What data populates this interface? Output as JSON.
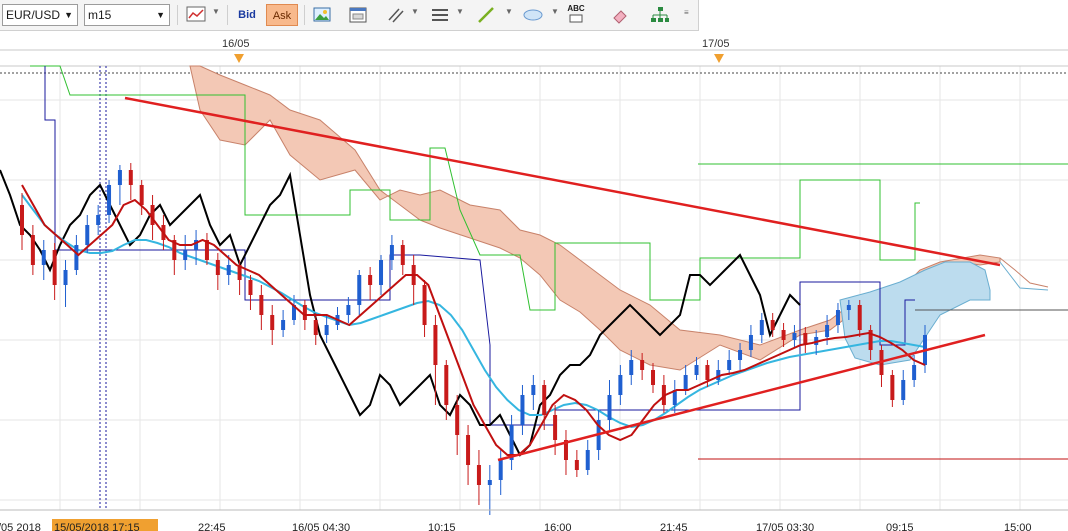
{
  "toolbar": {
    "symbol": "EUR/USD",
    "timeframe": "m15",
    "bid_label": "Bid",
    "ask_label": "Ask",
    "text_tool_label": "ABC"
  },
  "chart_data": {
    "type": "line",
    "date_markers": [
      "16/05",
      "17/05"
    ],
    "x_ticks": [
      "/05 2018",
      "15/05/2018 17:15",
      "22:45",
      "16/05 04:30",
      "10:15",
      "16:00",
      "21:45",
      "17/05 03:30",
      "09:15",
      "15:00"
    ],
    "highlighted_tick": "15/05/2018 17:15",
    "colors": {
      "candle_up": "#1f5fd0",
      "candle_down": "#c81a1a",
      "black_line": "#000000",
      "red_line": "#c01010",
      "cyan_line": "#35b6e0",
      "green_line": "#30c030",
      "navy_line": "#1a1a9e",
      "cloud_bear": "#f3c8b5",
      "cloud_bull": "#bcdcee",
      "trendline": "#e02020"
    },
    "candles": [
      {
        "o": 130,
        "c": 160,
        "h": 118,
        "l": 175
      },
      {
        "o": 160,
        "c": 190,
        "h": 150,
        "l": 200
      },
      {
        "o": 190,
        "c": 175,
        "h": 165,
        "l": 205
      },
      {
        "o": 175,
        "c": 210,
        "h": 168,
        "l": 225
      },
      {
        "o": 210,
        "c": 195,
        "h": 185,
        "l": 232
      },
      {
        "o": 195,
        "c": 170,
        "h": 160,
        "l": 200
      },
      {
        "o": 170,
        "c": 150,
        "h": 140,
        "l": 178
      },
      {
        "o": 150,
        "c": 140,
        "h": 130,
        "l": 160
      },
      {
        "o": 140,
        "c": 110,
        "h": 105,
        "l": 148
      },
      {
        "o": 110,
        "c": 95,
        "h": 90,
        "l": 130
      },
      {
        "o": 95,
        "c": 110,
        "h": 88,
        "l": 125
      },
      {
        "o": 110,
        "c": 130,
        "h": 105,
        "l": 140
      },
      {
        "o": 130,
        "c": 150,
        "h": 120,
        "l": 165
      },
      {
        "o": 150,
        "c": 165,
        "h": 140,
        "l": 175
      },
      {
        "o": 165,
        "c": 185,
        "h": 160,
        "l": 200
      },
      {
        "o": 185,
        "c": 175,
        "h": 160,
        "l": 195
      },
      {
        "o": 175,
        "c": 165,
        "h": 155,
        "l": 190
      },
      {
        "o": 165,
        "c": 185,
        "h": 158,
        "l": 190
      },
      {
        "o": 185,
        "c": 200,
        "h": 178,
        "l": 215
      },
      {
        "o": 200,
        "c": 190,
        "h": 180,
        "l": 210
      },
      {
        "o": 190,
        "c": 205,
        "h": 185,
        "l": 220
      },
      {
        "o": 205,
        "c": 220,
        "h": 200,
        "l": 235
      },
      {
        "o": 220,
        "c": 240,
        "h": 210,
        "l": 255
      },
      {
        "o": 240,
        "c": 255,
        "h": 230,
        "l": 270
      },
      {
        "o": 255,
        "c": 245,
        "h": 235,
        "l": 262
      },
      {
        "o": 245,
        "c": 230,
        "h": 220,
        "l": 250
      },
      {
        "o": 230,
        "c": 245,
        "h": 225,
        "l": 255
      },
      {
        "o": 245,
        "c": 260,
        "h": 238,
        "l": 270
      },
      {
        "o": 260,
        "c": 250,
        "h": 240,
        "l": 268
      },
      {
        "o": 250,
        "c": 240,
        "h": 232,
        "l": 255
      },
      {
        "o": 240,
        "c": 230,
        "h": 222,
        "l": 248
      },
      {
        "o": 230,
        "c": 200,
        "h": 195,
        "l": 240
      },
      {
        "o": 200,
        "c": 210,
        "h": 192,
        "l": 225
      },
      {
        "o": 210,
        "c": 185,
        "h": 180,
        "l": 220
      },
      {
        "o": 185,
        "c": 170,
        "h": 160,
        "l": 195
      },
      {
        "o": 170,
        "c": 190,
        "h": 165,
        "l": 200
      },
      {
        "o": 190,
        "c": 210,
        "h": 180,
        "l": 230
      },
      {
        "o": 210,
        "c": 250,
        "h": 205,
        "l": 262
      },
      {
        "o": 250,
        "c": 290,
        "h": 240,
        "l": 330
      },
      {
        "o": 290,
        "c": 330,
        "h": 285,
        "l": 345
      },
      {
        "o": 330,
        "c": 360,
        "h": 320,
        "l": 380
      },
      {
        "o": 360,
        "c": 390,
        "h": 350,
        "l": 410
      },
      {
        "o": 390,
        "c": 410,
        "h": 375,
        "l": 430
      },
      {
        "o": 410,
        "c": 405,
        "h": 390,
        "l": 440
      },
      {
        "o": 405,
        "c": 385,
        "h": 375,
        "l": 420
      },
      {
        "o": 385,
        "c": 350,
        "h": 340,
        "l": 395
      },
      {
        "o": 350,
        "c": 320,
        "h": 310,
        "l": 360
      },
      {
        "o": 320,
        "c": 310,
        "h": 300,
        "l": 335
      },
      {
        "o": 310,
        "c": 340,
        "h": 305,
        "l": 355
      },
      {
        "o": 340,
        "c": 365,
        "h": 330,
        "l": 380
      },
      {
        "o": 365,
        "c": 385,
        "h": 355,
        "l": 400
      },
      {
        "o": 385,
        "c": 395,
        "h": 375,
        "l": 402
      },
      {
        "o": 395,
        "c": 375,
        "h": 365,
        "l": 400
      },
      {
        "o": 375,
        "c": 345,
        "h": 335,
        "l": 385
      },
      {
        "o": 345,
        "c": 320,
        "h": 305,
        "l": 355
      },
      {
        "o": 320,
        "c": 300,
        "h": 290,
        "l": 330
      },
      {
        "o": 300,
        "c": 285,
        "h": 275,
        "l": 310
      },
      {
        "o": 285,
        "c": 295,
        "h": 278,
        "l": 305
      },
      {
        "o": 295,
        "c": 310,
        "h": 288,
        "l": 318
      },
      {
        "o": 310,
        "c": 330,
        "h": 300,
        "l": 338
      },
      {
        "o": 330,
        "c": 315,
        "h": 305,
        "l": 338
      },
      {
        "o": 315,
        "c": 300,
        "h": 290,
        "l": 320
      },
      {
        "o": 300,
        "c": 290,
        "h": 282,
        "l": 305
      },
      {
        "o": 290,
        "c": 305,
        "h": 285,
        "l": 312
      },
      {
        "o": 305,
        "c": 295,
        "h": 285,
        "l": 310
      },
      {
        "o": 295,
        "c": 285,
        "h": 275,
        "l": 300
      },
      {
        "o": 285,
        "c": 275,
        "h": 268,
        "l": 295
      },
      {
        "o": 275,
        "c": 260,
        "h": 250,
        "l": 282
      },
      {
        "o": 260,
        "c": 245,
        "h": 238,
        "l": 268
      },
      {
        "o": 245,
        "c": 255,
        "h": 238,
        "l": 262
      },
      {
        "o": 255,
        "c": 265,
        "h": 248,
        "l": 272
      },
      {
        "o": 265,
        "c": 258,
        "h": 250,
        "l": 272
      },
      {
        "o": 258,
        "c": 270,
        "h": 252,
        "l": 278
      },
      {
        "o": 270,
        "c": 262,
        "h": 255,
        "l": 280
      },
      {
        "o": 262,
        "c": 250,
        "h": 240,
        "l": 270
      },
      {
        "o": 250,
        "c": 235,
        "h": 228,
        "l": 258
      },
      {
        "o": 235,
        "c": 230,
        "h": 225,
        "l": 245
      },
      {
        "o": 230,
        "c": 255,
        "h": 225,
        "l": 262
      },
      {
        "o": 255,
        "c": 275,
        "h": 250,
        "l": 285
      },
      {
        "o": 275,
        "c": 300,
        "h": 270,
        "l": 312
      },
      {
        "o": 300,
        "c": 325,
        "h": 295,
        "l": 332
      },
      {
        "o": 325,
        "c": 305,
        "h": 295,
        "l": 330
      },
      {
        "o": 305,
        "c": 290,
        "h": 280,
        "l": 312
      },
      {
        "o": 290,
        "c": 260,
        "h": 250,
        "l": 298
      }
    ],
    "black_line": [
      95,
      120,
      150,
      160,
      175,
      195,
      170,
      150,
      140,
      120,
      110,
      130,
      150,
      170,
      160,
      140,
      130,
      150,
      140,
      130,
      120,
      150,
      170,
      160,
      190,
      170,
      150,
      130,
      120,
      100,
      160,
      220,
      260,
      280,
      300,
      320,
      340,
      330,
      300,
      310,
      330,
      320,
      310,
      300,
      330,
      340,
      320,
      330,
      350,
      350,
      340,
      360,
      380,
      370,
      330,
      320,
      300,
      290,
      290,
      280,
      260,
      250,
      240,
      230,
      240,
      250,
      260,
      250,
      240,
      200,
      200,
      210,
      200,
      190,
      180,
      200,
      220,
      260,
      240,
      220,
      230
    ],
    "red_line": [
      110,
      130,
      150,
      160,
      170,
      180,
      170,
      160,
      150,
      130,
      125,
      135,
      150,
      165,
      170,
      170,
      165,
      170,
      180,
      190,
      195,
      200,
      210,
      220,
      230,
      240,
      240,
      240,
      245,
      250,
      240,
      230,
      220,
      210,
      200,
      200,
      210,
      240,
      270,
      300,
      330,
      350,
      370,
      380,
      380,
      370,
      350,
      330,
      320,
      325,
      335,
      350,
      360,
      365,
      360,
      345,
      330,
      320,
      315,
      315,
      310,
      305,
      300,
      298,
      295,
      290,
      285,
      280,
      275,
      270,
      268,
      265,
      263,
      262,
      260,
      258,
      262,
      268,
      275,
      285,
      290
    ],
    "cyan_line": [
      120,
      135,
      150,
      160,
      168,
      175,
      178,
      178,
      176,
      170,
      165,
      165,
      168,
      172,
      178,
      182,
      186,
      190,
      194,
      198,
      202,
      206,
      212,
      218,
      225,
      232,
      238,
      242,
      246,
      250,
      248,
      244,
      240,
      236,
      232,
      228,
      226,
      230,
      240,
      255,
      275,
      295,
      312,
      325,
      335,
      340,
      340,
      335,
      330,
      328,
      330,
      335,
      342,
      348,
      352,
      350,
      345,
      338,
      330,
      322,
      315,
      310,
      305,
      300,
      296,
      292,
      288,
      285,
      282,
      280,
      278,
      276,
      274,
      272,
      270,
      268,
      266,
      266,
      268,
      270,
      272
    ]
  }
}
